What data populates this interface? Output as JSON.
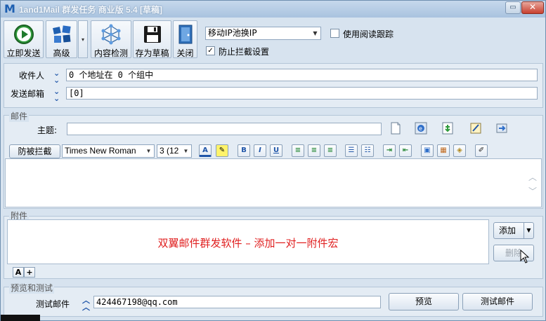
{
  "window": {
    "title": "1and1Mail 群发任务 商业版 5.4 [草稿]",
    "min_glyph": "▭",
    "close_glyph": "✕"
  },
  "toolbar": {
    "send_now": "立即发送",
    "advanced": "高级",
    "dropdown_glyph": "▾",
    "content_check": "内容检测",
    "save_draft": "存为草稿",
    "close": "关闭",
    "ip_mode": "移动IP池换IP",
    "read_tracking_label": "使用阅读跟踪",
    "read_tracking_checked": false,
    "anti_block_label": "防止拦截设置",
    "anti_block_checked": true
  },
  "recipients": {
    "to_label": "收件人",
    "to_value": "0 个地址在 0 个组中",
    "sender_label": "发送邮箱",
    "sender_value": "[0]"
  },
  "mail": {
    "section_title": "邮件",
    "subject_label": "主题:",
    "subject_value": "",
    "anti_block_button": "防被拦截",
    "font_name": "Times New Roman",
    "font_size": "3 (12",
    "bold": "B",
    "italic": "I",
    "underline": "U"
  },
  "attachments": {
    "section_title": "附件",
    "add_button": "添加",
    "delete_button": "删除",
    "promo_text": "双翼邮件群发软件 – 添加一对一附件宏",
    "font_a": "A",
    "font_plus": "+"
  },
  "preview": {
    "section_title": "预览和测试",
    "test_email_label": "测试邮件",
    "test_email_value": "424467198@qq.com",
    "preview_button": "预览",
    "test_mail_button": "测试邮件"
  },
  "colors": {
    "accent": "#1f55a8",
    "promo_red": "#e02020",
    "window_bg": "#d7e3ef"
  }
}
